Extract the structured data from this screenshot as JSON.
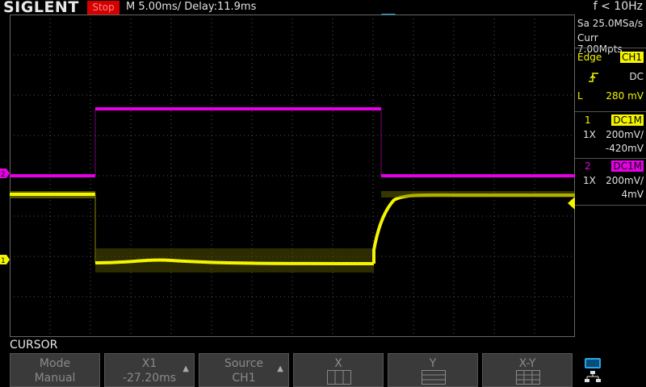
{
  "header": {
    "brand": "SIGLENT",
    "run_status": "Stop",
    "timebase": "M 5.00ms/ Delay:11.9ms",
    "frequency": "f < 10Hz"
  },
  "side_panel": {
    "sample_rate": "Sa 25.0MSa/s",
    "memory_depth": "Curr 7.00Mpts",
    "trigger": {
      "type": "Edge",
      "source": "CH1",
      "slope_icon": "rising-edge-icon",
      "coupling": "DC",
      "level_label": "L",
      "level_value": "280 mV"
    },
    "ch1": {
      "number": "1",
      "coupling": "DC1M",
      "probe": "1X",
      "vdiv": "200mV/",
      "offset": "-420mV"
    },
    "ch2": {
      "number": "2",
      "coupling": "DC1M",
      "probe": "1X",
      "vdiv": "200mV/",
      "offset": "4mV"
    }
  },
  "markers": {
    "ch1_marker": "1",
    "ch2_marker": "2"
  },
  "menu": {
    "title": "CURSOR",
    "softkeys": [
      {
        "line1": "Mode",
        "line2": "Manual"
      },
      {
        "line1": "X1",
        "line2": "-27.20ms"
      },
      {
        "line1": "Source",
        "line2": "CH1"
      },
      {
        "line1": "X",
        "line2": ""
      },
      {
        "line1": "Y",
        "line2": ""
      },
      {
        "line1": "X-Y",
        "line2": ""
      }
    ]
  },
  "colors": {
    "ch1": "#f5f500",
    "ch2": "#e600e6",
    "trigger": "#29a8e0",
    "grid": "#555555"
  }
}
